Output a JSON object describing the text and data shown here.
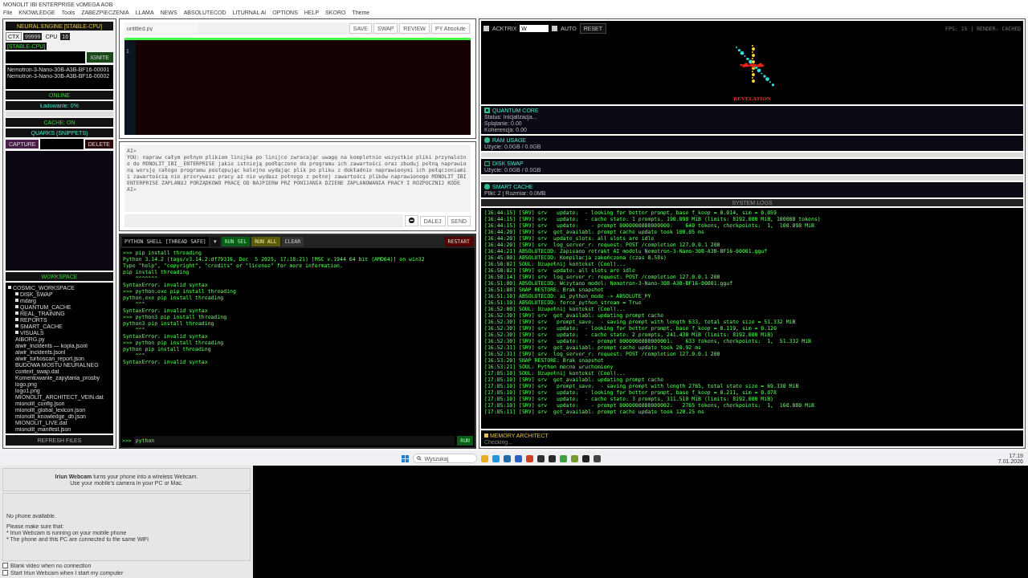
{
  "window": {
    "title": "MONOLIT IBI ENTERPRISE vOMEGA AOB",
    "menu": [
      "File",
      "KNOWLEDGE",
      "Tools",
      "ZABEZPIECZENIA",
      "LLAMA",
      "NEWS",
      "ABSOLUTECOD",
      "LITURNAL AI",
      "OPTIONS",
      "HELP",
      "SKORO",
      "Theme"
    ]
  },
  "engine": {
    "title": "NEURAL ENGINE [STABLE-CPU]",
    "ctx_label": "CTX",
    "ctx_value": "99999",
    "cpu_label": "CPU",
    "cpu_value": "16",
    "mode_tag": "[STABLE-CPU]",
    "ignite": "IGNITE",
    "models": [
      "Nemotron-3-Nano-30B-A3B-BF16-00001",
      "Nemotron-3-Nano-30B-A3B-BF16-00002"
    ],
    "status": "ONLINE",
    "loading": "Ładowanie: 0%",
    "loading_bar": {
      "level": 0
    },
    "cache": "CACHE: ON"
  },
  "quarks": {
    "title": "QUARKS (SNIPPETS)",
    "capture": "CAPTURE",
    "delete": "DELETE"
  },
  "workspace": {
    "title": "WORKSPACE",
    "refresh": "REFRESH FILES",
    "tree": [
      {
        "label": "COSMIC_WORKSPACE",
        "kind": "folder",
        "children": [
          {
            "label": "DISK_SWAP",
            "kind": "folder"
          },
          {
            "label": "mdarg",
            "kind": "folder"
          },
          {
            "label": "QUANTUM_CACHE",
            "kind": "folder"
          },
          {
            "label": "REAL_TRAINING",
            "kind": "folder"
          },
          {
            "label": "REPORTS",
            "kind": "folder"
          },
          {
            "label": "SMART_CACHE",
            "kind": "folder"
          },
          {
            "label": "VISUALS",
            "kind": "folder"
          },
          {
            "label": "AIBORG.py",
            "kind": "file"
          },
          {
            "label": "aiwir_incidents — kopia.jsonl",
            "kind": "file"
          },
          {
            "label": "aiwir_incidents.jsonl",
            "kind": "file"
          },
          {
            "label": "aiwir_turboscan_report.json",
            "kind": "file"
          },
          {
            "label": "BUDOWA MOSTU NEURALNEG",
            "kind": "file"
          },
          {
            "label": "context_swap.dat",
            "kind": "file"
          },
          {
            "label": "Komentowanie_zapytania_prosby",
            "kind": "file"
          },
          {
            "label": "logo.png",
            "kind": "file"
          },
          {
            "label": "logo1.png",
            "kind": "file"
          },
          {
            "label": "MIONOLIT_ARCHITECT_VEIN.dat",
            "kind": "file"
          },
          {
            "label": "mionolit_config.json",
            "kind": "file"
          },
          {
            "label": "mionolit_global_lexicon.json",
            "kind": "file"
          },
          {
            "label": "mionolit_knowledge_db.json",
            "kind": "file"
          },
          {
            "label": "MIONOLIT_LIVE.dat",
            "kind": "file"
          },
          {
            "label": "mionolit_manifest.json",
            "kind": "file"
          }
        ]
      }
    ]
  },
  "editor": {
    "filename": "untitled.py",
    "buttons": [
      "SAVE",
      "SWAP",
      "REVIEW",
      "PY Absolute"
    ],
    "line_number": "1"
  },
  "chat": {
    "lines": [
      "AI>",
      "YOU: napraw całym pełnym plikiem linijka po linijce zwracając uwagę na kompletnie wszystkie pliki przynależne do MONOLIT_IBI__ENTERPRISE jakie istnieją podłączone do programu ich zawartości oraz zbuduj pełną naprawioną wersję całego programu postępując kolejno wydając plik po pliku z dokładnie naprawionymi ich połączeniami i zawartością nie przerywasz pracy aż nie wydasz pełnego z pełnej zawartości plików naprawionego MONOLIT_IBI ENTERPRISE ZAPLANUJ PORZĄDKOWO PRACĘ OD NAJPIERW PRZ PONIJANIA DZIENE ZAPLANOWANIA PRACY I ROZPOCZNIJ KODE",
      "AI>"
    ],
    "dalej": "DALEJ",
    "send": "SEND"
  },
  "shell": {
    "title": "PYTHON SHELL [THREAD SAFE]",
    "dropdown": "▾",
    "buttons": [
      {
        "label": "RUN SEL",
        "kind": "run"
      },
      {
        "label": "RUN ALL",
        "kind": "all"
      },
      {
        "label": "CLEAR",
        "kind": "clear"
      }
    ],
    "restart": "RESTART",
    "lines": [
      ">>> pip install threading",
      "Python 3.14.2 (tags/v3.14.2:df79316, Dec  5 2025, 17:18:21) [MSC v.1944 64 bit (AMD64)] on win32",
      "Type \"help\", \"copyright\", \"credits\" or \"license\" for more information.",
      "pip install threading",
      "    ^^^^^^^",
      "SyntaxError: invalid syntax",
      ">>> python.exe pip install threading",
      "python.exe pip install threading",
      "    ^^^",
      "SyntaxError: invalid syntax",
      ">>> python3 pip install threading",
      "python3 pip install threading",
      "    ^^^",
      "SyntaxError: invalid syntax",
      ">>> python pip install threading",
      "python pip install threading",
      "    ^^^",
      "SyntaxError: invalid syntax"
    ],
    "prompt": ">>>",
    "input": "python",
    "run": "RUN"
  },
  "visual": {
    "acktrix": {
      "label": "ACKTRIX",
      "checked": true
    },
    "mode": "W",
    "auto": {
      "label": "AUTO",
      "checked": true
    },
    "reset": "RESET",
    "stats": "FPS: 15 | RENDER: CACHED",
    "caption": "REVELATION"
  },
  "panels": [
    {
      "title": "QUANTUM CORE",
      "kind": "core",
      "lines": [
        "Status: Inicjalizacja...",
        "Splątanie: 0.00",
        "Koherencja: 0.00"
      ]
    },
    {
      "title": "RAM USAGE",
      "kind": "meter",
      "lines": [
        "Użycie: 0.0GB / 0.0GB"
      ],
      "level": 0
    },
    {
      "title": "DISK SWAP",
      "kind": "disk",
      "lines": [
        "Użycie: 0.0GB / 0.0GB"
      ],
      "level": 0
    },
    {
      "title": "SMART CACHE",
      "kind": "cache",
      "lines": [
        "Pliki: 2 | Rozmiar: 0.0MB"
      ]
    }
  ],
  "logs": {
    "title": "SYSTEM LOGS",
    "lines": [
      "[16:44:15] [SRV] srv   update:  - looking for better prompt, base f_keep = 0.014, sim = 0.059",
      "[16:44:15] [SRV] srv   update:  - cache state: 1 prompts, 190.098 MiB (limits: 8192.000 MiB, 100000 tokens)",
      "[16:44:15] [SRV] srv   update:    - prompt 0000000000000000:    640 tokens, checkpoints:  1,  100.098 MiB",
      "[16:44:20] [SRV] srv  get_availabl: prompt cache update took 100.05 ms",
      "[16:44:20] [SRV] srv  update_slots: all slots are idle",
      "[16:44:20] [SRV] srv  log_server_r: request: POST /completion 127.0.0.1 200",
      "[16:44:21] ABSOLUTECOD: Zapisano retrakt AI modelu Nemotron-3-Nano-30B-A3B-BF16-00001.gguf",
      "[16:45:00] ABSOLUTECOD: Kompilacja zakończona (czas 0.58s)",
      "[16:50:02] SOUL: Uzupełnij kontekst (Cool)...",
      "[16:50:02] [SRV] srv  update: all slots are idle",
      "[16:50:14] [SRV] srv  log_server_r: request: POST /completion 127.0.0.1 200",
      "[16:51:00] ABSOLUTECOD: Wczytano model: Nemotron-3-Nano-30B-A3B-BF16-00001.gguf",
      "[16:51:08] SNAP RESTORE: Brak snapshot",
      "[16:51:10] ABSOLUTECOD: ai_python_mode -> ABSOLUTE_PY",
      "[16:51:10] ABSOLUTECOD: force_python_stream = True",
      "[16:52:00] SOUL: Uzupełnij kontekst (Cool)...",
      "[16:52:30] [SRV] srv  get_availabl: updating prompt cache",
      "[16:52:30] [SRV] srv   prompt_save:  - saving prompt with length 633, total state size = 51.332 MiB",
      "[16:52:30] [SRV] srv   update:  - looking for better prompt, base f_keep = 0.119, sim = 0.120",
      "[16:52:30] [SRV] srv   update:  - cache state: 2 prompts, 241.430 MiB (limits: 8192.000 MiB)",
      "[16:52:30] [SRV] srv   update:    - prompt 0000000000000001:    633 tokens, checkpoints:  1,  51.332 MiB",
      "[16:52:31] [SRV] srv  get_availabl: prompt cache update took 20.92 ms",
      "[16:52:31] [SRV] srv  log_server_r: request: POST /completion 127.0.0.1 200",
      "[16:53:20] SNAP RESTORE: Brak snapshot",
      "[16:53:21] SOUL: Python mocno uruchomiony",
      "[17:05:10] SOUL: Uzupełnij kontekst (Cool)...",
      "[17:05:10] [SRV] srv  get_availabl: updating prompt cache",
      "[17:05:10] [SRV] srv   prompt_save:  - saving prompt with length 2765, total state size = 69.330 MiB",
      "[17:05:10] [SRV] srv   update:  - looking for better prompt, base f_keep = 0.211, sim = 0.078",
      "[17:05:10] [SRV] srv   update:  - cache state: 3 prompts, 311.510 MiB (limits: 8192.000 MiB)",
      "[17:05:10] [SRV] srv   update:    - prompt 0000000000000002:   2765 tokens, checkpoints:  1,  160.080 MiB",
      "[17:05:11] [SRV] srv  get_availabl: prompt cache update took 120.25 ms"
    ],
    "architect_title": "MEMORY ARCHITECT",
    "architect_status": "Checking..."
  },
  "taskbar": {
    "search": "Wyszukaj",
    "time": "17:19",
    "date": "7.01.2026"
  },
  "webcam": {
    "brand": "Iriun Webcam",
    "intro": "turns your phone into a wireless Webcam.",
    "intro2": "Use your mobile's camera in your PC or Mac.",
    "status": "No phone available.",
    "checklist_title": "Please make sure that:",
    "checklist": [
      "* Iriun Webcam is running on your mobile phone",
      "* The phone and this PC are connected to the same WiFi"
    ],
    "options": [
      {
        "label": "Blank video when no connection",
        "checked": false
      },
      {
        "label": "Start Iriun Webcam when I start my computer",
        "checked": false
      }
    ]
  }
}
